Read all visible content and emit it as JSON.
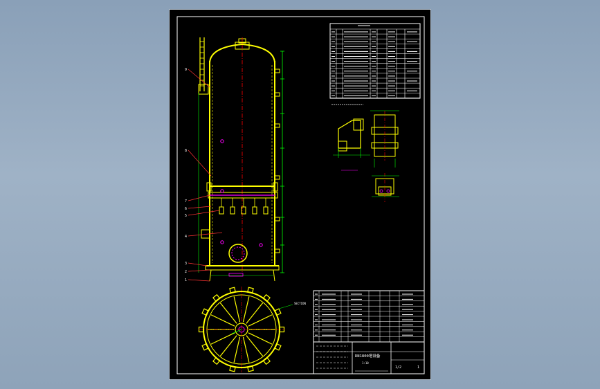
{
  "colors": {
    "desktop": "#8fa4ba",
    "sheet": "#000000",
    "frame": "#ffffff",
    "vessel": "#ffff00",
    "table": "#ffffff",
    "highlight": "#ff00ff",
    "dimension": "#00ff00",
    "centerline": "#ff0000",
    "leader": "#ff3333"
  },
  "leader_labels": [
    "9",
    "8",
    "7",
    "6",
    "5",
    "4",
    "3",
    "2",
    "1"
  ],
  "plan_view_note": "SECTION",
  "title_block": {
    "name": "DN1800塔设备",
    "drawing_no": "1/2",
    "scale": "1:10",
    "sheet": "1"
  }
}
